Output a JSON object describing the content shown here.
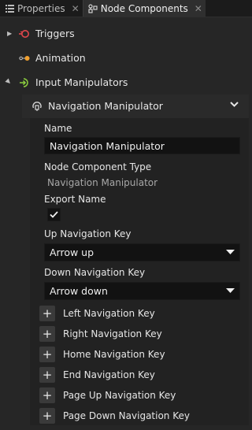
{
  "tabs": [
    {
      "label": "Properties",
      "icon": "properties-icon",
      "active": false
    },
    {
      "label": "Node Components",
      "icon": "node-components-icon",
      "active": true
    }
  ],
  "tree": {
    "triggers": {
      "label": "Triggers",
      "icon": "triggers-icon"
    },
    "animation": {
      "label": "Animation",
      "icon": "animation-icon"
    },
    "input_manipulators": {
      "label": "Input Manipulators",
      "icon": "input-manipulators-icon"
    }
  },
  "component": {
    "title": "Navigation Manipulator",
    "fields": {
      "name_label": "Name",
      "name_value": "Navigation Manipulator",
      "type_label": "Node Component Type",
      "type_value": "Navigation Manipulator",
      "export_label": "Export Name",
      "export_checked": true,
      "up_label": "Up Navigation Key",
      "up_value": "Arrow up",
      "down_label": "Down Navigation Key",
      "down_value": "Arrow down"
    },
    "add_properties": [
      "Left Navigation Key",
      "Right Navigation Key",
      "Home Navigation Key",
      "End Navigation Key",
      "Page Up Navigation Key",
      "Page Down Navigation Key"
    ]
  },
  "colors": {
    "background": "#262626",
    "field_background": "#121212",
    "triggers_icon": "#e0474c",
    "animation_icon": "#f0a030",
    "input_manipulators_icon": "#8ccf3f"
  }
}
